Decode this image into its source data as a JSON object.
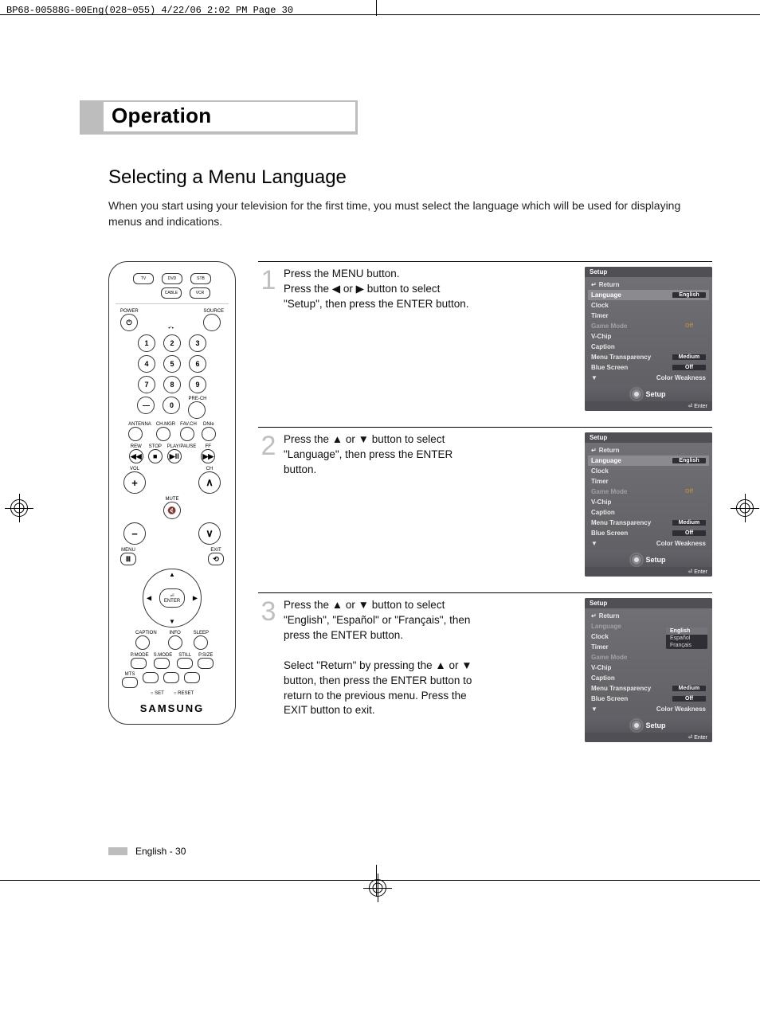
{
  "crop_header": "BP68-00588G-00Eng(028~055)  4/22/06  2:02 PM  Page 30",
  "section_title": "Operation",
  "subtitle": "Selecting a Menu Language",
  "intro": "When you start using your television for the first time, you must select the language which will be used for displaying menus and indications.",
  "steps": [
    {
      "num": "1",
      "text": "Press the MENU button.\nPress the ◀ or ▶ button to select \"Setup\", then press the ENTER button."
    },
    {
      "num": "2",
      "text": "Press the ▲ or ▼ button to select \"Language\", then press the ENTER button."
    },
    {
      "num": "3",
      "text": "Press the ▲ or ▼ button to select \"English\", \"Español\" or \"Français\", then press the ENTER button.\n\nSelect \"Return\" by pressing the ▲ or ▼ button, then press the ENTER button to return to the previous menu. Press the EXIT button to exit."
    }
  ],
  "osd_common": {
    "title": "Setup",
    "return": "Return",
    "items": {
      "language": "Language",
      "clock": "Clock",
      "timer": "Timer",
      "game_mode": "Game Mode",
      "vchip": "V-Chip",
      "caption": "Caption",
      "menu_trans": "Menu Transparency",
      "blue_screen": "Blue Screen",
      "color_weak": "Color Weakness"
    },
    "vals": {
      "english": "English",
      "off": "Off",
      "medium": "Medium"
    },
    "footer_label": "Setup",
    "enter_label": "Enter"
  },
  "lang_options": [
    "English",
    "Español",
    "Français"
  ],
  "remote": {
    "brand": "SAMSUNG",
    "modes": [
      "TV",
      "DVD",
      "STB",
      "CABLE",
      "VCR"
    ],
    "power": "POWER",
    "source": "SOURCE",
    "nums": [
      "1",
      "2",
      "3",
      "4",
      "5",
      "6",
      "7",
      "8",
      "9",
      "0"
    ],
    "dash": "—",
    "prech": "PRE-CH",
    "row_labels_1": [
      "ANTENNA",
      "CH.MGR",
      "FAV.CH",
      "DNIe"
    ],
    "row_labels_2": [
      "REW",
      "STOP",
      "PLAY/PAUSE",
      "FF"
    ],
    "vol": "VOL",
    "ch": "CH",
    "mute": "MUTE",
    "menu": "MENU",
    "exit": "EXIT",
    "enter": "ENTER",
    "bottom1": [
      "CAPTION",
      "INFO",
      "SLEEP"
    ],
    "bottom2": [
      "P.MODE",
      "S.MODE",
      "STILL",
      "P.SIZE"
    ],
    "bottom3": [
      "MTS"
    ],
    "setreset": [
      "SET",
      "RESET"
    ]
  },
  "footer": {
    "lang": "English",
    "sep": " - ",
    "page": "30"
  }
}
